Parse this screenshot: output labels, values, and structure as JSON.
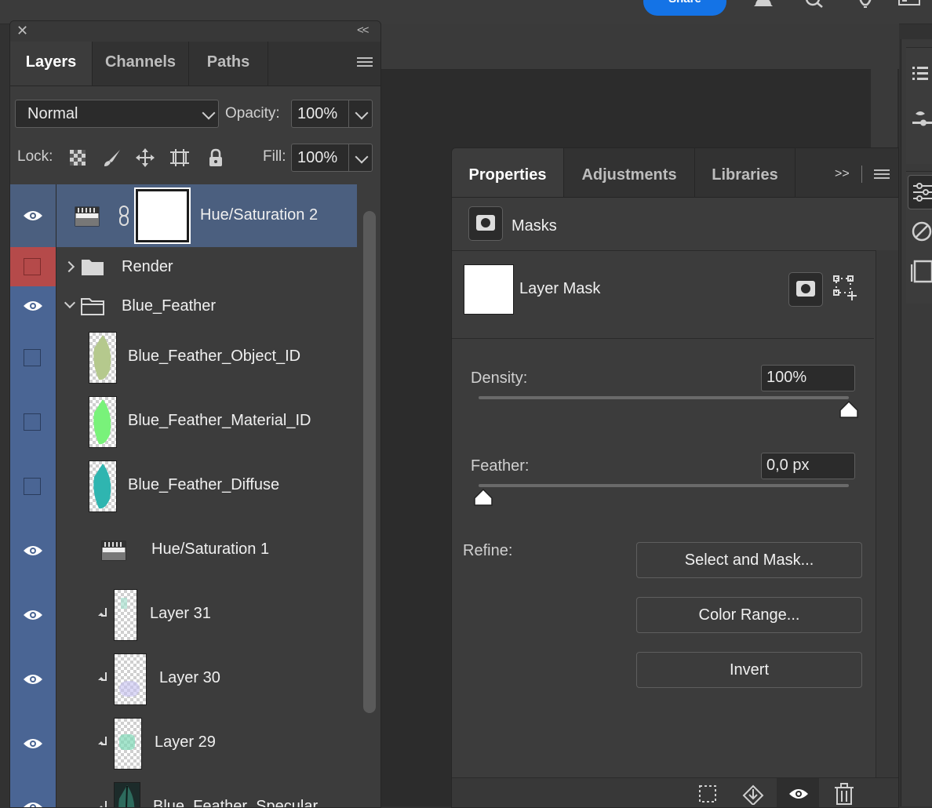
{
  "topbar": {
    "share_label": "Share"
  },
  "layers_panel": {
    "tabs": [
      {
        "label": "Layers",
        "active": true
      },
      {
        "label": "Channels",
        "active": false
      },
      {
        "label": "Paths",
        "active": false
      }
    ],
    "blend_mode": "Normal",
    "opacity_label": "Opacity:",
    "opacity_value": "100%",
    "lock_label": "Lock:",
    "fill_label": "Fill:",
    "fill_value": "100%",
    "layers": [
      {
        "name": "Hue/Saturation 2",
        "kind": "adjustment-with-mask",
        "visible": true,
        "selected": true
      },
      {
        "name": "Render",
        "kind": "group-collapsed",
        "visible": false,
        "color": "red"
      },
      {
        "name": "Blue_Feather",
        "kind": "group-expanded",
        "visible": true,
        "color": "blue"
      },
      {
        "name": "Blue_Feather_Object_ID",
        "kind": "layer",
        "visible": false,
        "color": "blue",
        "thumb": "#b5c98d"
      },
      {
        "name": "Blue_Feather_Material_ID",
        "kind": "layer",
        "visible": false,
        "color": "blue",
        "thumb": "#79f27a"
      },
      {
        "name": "Blue_Feather_Diffuse",
        "kind": "layer",
        "visible": false,
        "color": "blue",
        "thumb": "#2fb5b0"
      },
      {
        "name": "Hue/Saturation 1",
        "kind": "adjustment",
        "visible": true,
        "color": "blue"
      },
      {
        "name": "Layer 31",
        "kind": "clipped",
        "visible": true,
        "color": "blue"
      },
      {
        "name": "Layer 30",
        "kind": "clipped",
        "visible": true,
        "color": "blue"
      },
      {
        "name": "Layer 29",
        "kind": "clipped",
        "visible": true,
        "color": "blue"
      },
      {
        "name": "Blue_Feather_Specular",
        "kind": "clipped",
        "visible": true,
        "color": "blue"
      }
    ]
  },
  "properties_panel": {
    "tabs": [
      {
        "label": "Properties",
        "active": true
      },
      {
        "label": "Adjustments",
        "active": false
      },
      {
        "label": "Libraries",
        "active": false
      }
    ],
    "more_label": ">>",
    "section_label": "Masks",
    "mask_type_label": "Layer Mask",
    "density_label": "Density:",
    "density_value": "100%",
    "density_fraction": 1.0,
    "feather_label": "Feather:",
    "feather_value": "0,0 px",
    "feather_fraction": 0.0,
    "refine_label": "Refine:",
    "buttons": {
      "select_and_mask": "Select and Mask...",
      "color_range": "Color Range...",
      "invert": "Invert"
    }
  }
}
